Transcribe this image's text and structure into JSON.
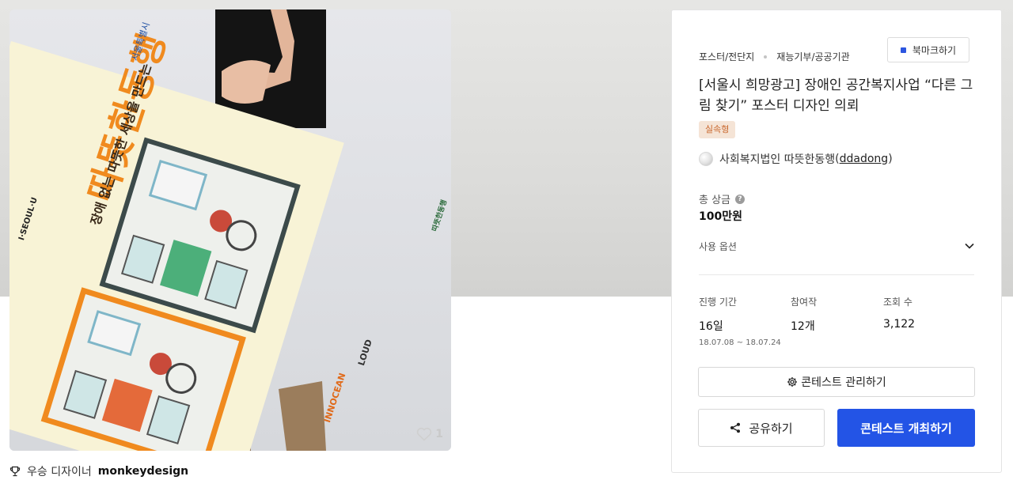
{
  "image": {
    "like_count": "1",
    "poster_headline": "따뜻한동행",
    "poster_subhead": "장애 없는 따뜻한 세상을 만드는",
    "poster_logo_top": "서울특별시",
    "poster_logo_left": "I·SEOUL·U",
    "poster_logo_bottom": "INNOCEAN",
    "poster_logo_loud": "LOUD",
    "poster_logo_right": "따뜻한동행"
  },
  "winner": {
    "label": "우승 디자이너",
    "name": "monkeydesign"
  },
  "panel": {
    "category": "포스터/전단지",
    "subcategory": "재능기부/공공기관",
    "bookmark_label": "북마크하기",
    "title": "[서울시 희망광고] 장애인 공간복지사업 “다른 그림 찾기” 포스터 디자인 의뢰",
    "badge": "실속형",
    "host_name": "사회복지법인 따뜻한동행",
    "host_handle": "ddadong",
    "prize_label": "총 상금",
    "prize_value": "100만원",
    "options_label": "사용 옵션",
    "stats": {
      "period_label": "진행 기간",
      "period_value": "16일",
      "period_dates": "18.07.08 ~ 18.07.24",
      "entries_label": "참여작",
      "entries_value": "12개",
      "views_label": "조회 수",
      "views_value": "3,122"
    },
    "manage_label": "콘테스트 관리하기",
    "share_label": "공유하기",
    "host_contest_label": "콘테스트 개최하기"
  },
  "colors": {
    "accent": "#2354e6",
    "badge_bg": "#f5e4d6",
    "badge_text": "#c9682e",
    "poster_bg": "#f8f3d6",
    "poster_orange": "#f08a1e"
  }
}
